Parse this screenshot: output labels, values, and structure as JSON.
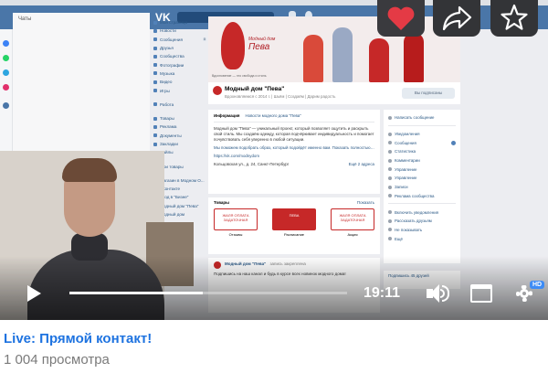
{
  "video": {
    "title": "Live: Прямой контакт!",
    "views": "1 004 просмотра",
    "time": "19:11",
    "progress_fraction": 0.48,
    "quality_badge": "HD",
    "controls": {
      "play_icon": "play-icon",
      "volume_icon": "volume-icon",
      "fullscreen_icon": "fullscreen-icon",
      "settings_icon": "gear-icon"
    },
    "overlay": {
      "like_icon": "heart-icon",
      "share_icon": "share-icon",
      "favorite_icon": "star-icon"
    }
  },
  "screen": {
    "vk_logo": "VK",
    "left_panel_title": "Чаты",
    "menu": [
      "Моя страница",
      "Новости",
      "Сообщения",
      "Друзья",
      "Сообщества",
      "Фотографии",
      "Музыка",
      "Видео",
      "Игры"
    ],
    "menu2": [
      "Работа"
    ],
    "menu3": [
      "Товары",
      "Реклама",
      "Документы",
      "Закладки",
      "Файлы"
    ],
    "menu4": [
      "Мои товары"
    ],
    "menu5": [
      "Магазин в Модном О...",
      "ВКонтакте",
      "Вход в \"Бизне\"",
      "Модный дом \"Пева\"",
      "Модный дом "
    ],
    "menu_count": "8",
    "cover_title_small": "Модный дом",
    "cover_title_big": "Пева",
    "cover_note": "Вдохновение — это свобода и стиль",
    "group_name": "Модный дом \"Пева\"",
    "group_status": "Вдохновляемся с 2014 г. | Шьём | Создаём | Дарим радость",
    "subscribed_label": "Вы подписаны",
    "info_tabs": [
      "Информация",
      "Новости модного дома \"Пева\""
    ],
    "info_text": "Модный дом \"Пева\" — уникальный проект, который позволяет ощутить и раскрыть свой стиль. Мы создаём одежду, которая подчёркивает индивидуальность и помогает почувствовать себя уверенно в любой ситуации.",
    "info_text2": "Мы поможем подобрать образ, который подойдёт именно вам. Показать полностью…",
    "info_link": "https://vk.com/modnydom",
    "info_address": "Кольцовская ул., д. 24, Санкт-Петербург",
    "info_more": "Ещё 2 адреса",
    "products_title": "Товары",
    "products_all": "Показать",
    "products": [
      {
        "banner": "ЖАЛЯ ОПЛАТА ЗАДАТОЧНАЯ",
        "caption": "Отзывы"
      },
      {
        "banner": "ПЕВА",
        "caption": "Расписание"
      },
      {
        "banner": "ЖАЛЯ ОПЛАТА ЗАДАТОЧНАЯ",
        "caption": "Акция"
      }
    ],
    "post_author": "Модный дом \"Пева\"",
    "post_meta": "запись закреплена",
    "post_text": "Подпишись на наш канал и будь в курсе всех новинок модного дома!",
    "right_menu": [
      "Написать сообщение"
    ],
    "right_menu2": [
      "Уведомления",
      "Сообщения",
      "Статистика",
      "Комментарии",
      "Управление",
      "Управление",
      "Записи",
      "Реклама сообщества"
    ],
    "right_menu3": [
      "Включить уведомления",
      "Рассказать друзьям",
      "Не показывать",
      "Ещё"
    ],
    "right_footer": "Подпишись 45 друзей"
  },
  "colors": {
    "vk_blue": "#4a76a8",
    "link_blue": "#1e73e0",
    "hd_blue": "#3e8cf5",
    "brand_red": "#c62828"
  }
}
